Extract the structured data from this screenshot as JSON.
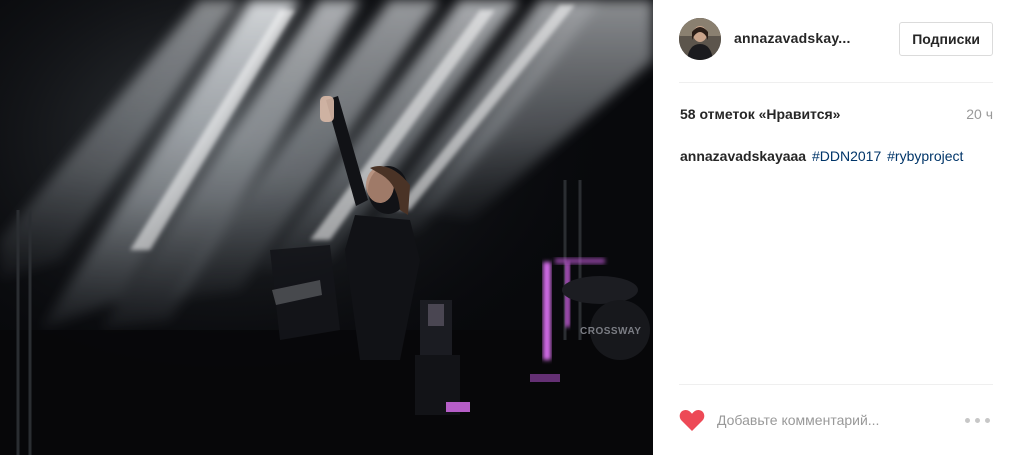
{
  "post": {
    "image_alt": "",
    "colors": {
      "photo_bg": "#090a0d",
      "beam": "#e8edf2",
      "pink_light": "#d36ce8"
    }
  },
  "stage_sign": "CROSSWAY",
  "header": {
    "username": "annazavadskay...",
    "follow_label": "Подписки"
  },
  "stats": {
    "likes": "58 отметок «Нравится»",
    "time": "20 ч"
  },
  "caption": {
    "author": "annazavadskayaaa",
    "tags": [
      "#DDN2017",
      "#rybyproject"
    ]
  },
  "comment": {
    "placeholder": "Добавьте комментарий...",
    "like_icon": "heart-icon",
    "like_color": "#ed4956",
    "more_icon": "more-options-icon"
  }
}
